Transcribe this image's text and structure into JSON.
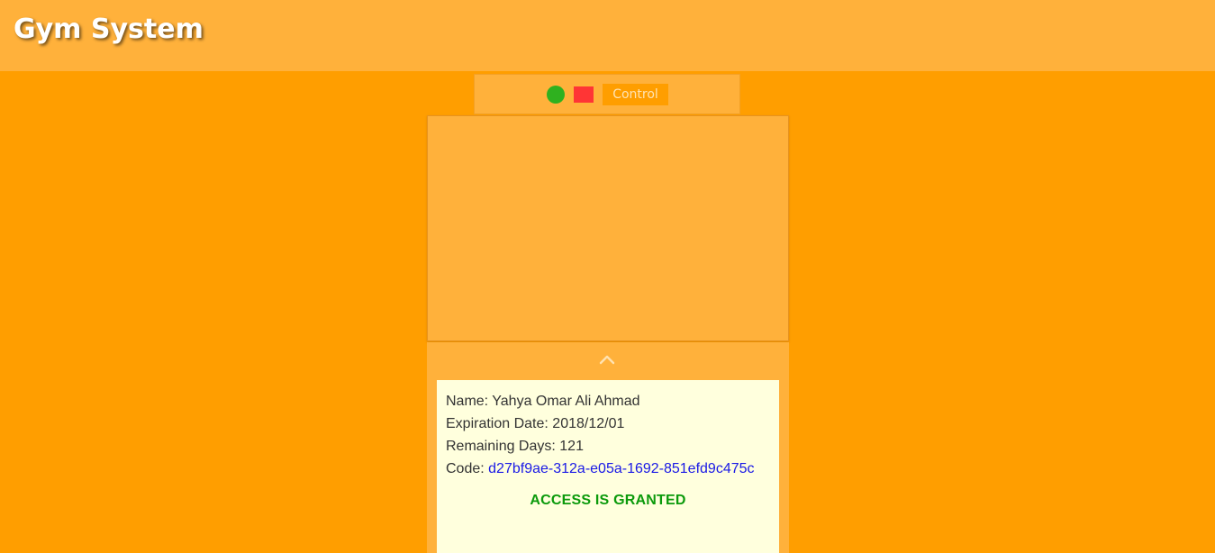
{
  "header": {
    "title": "Gym System",
    "background": "#ffb13b"
  },
  "control_bar": {
    "status_indicator_color": "#2fb11f",
    "stop_indicator_color": "#ff3535",
    "control_label": "Control"
  },
  "member_info": {
    "name_label": "Name:",
    "name": "Yahya Omar Ali Ahmad",
    "expiration_label": "Expiration Date:",
    "expiration_date": "2018/12/01",
    "remaining_label": "Remaining Days:",
    "remaining_days": "121",
    "code_label": "Code:",
    "code": "d27bf9ae-312a-e05a-1692-851efd9c475c",
    "access_status": "ACCESS IS GRANTED",
    "access_color": "#0b9a0b"
  },
  "icons": {
    "status": "circle-icon",
    "stop": "square-icon",
    "collapse": "chevron-up-icon"
  },
  "colors": {
    "page_background": "#ff9e00",
    "panel": "#ffb13b",
    "card": "#ffffdd",
    "code_link": "#1a1ae6"
  }
}
